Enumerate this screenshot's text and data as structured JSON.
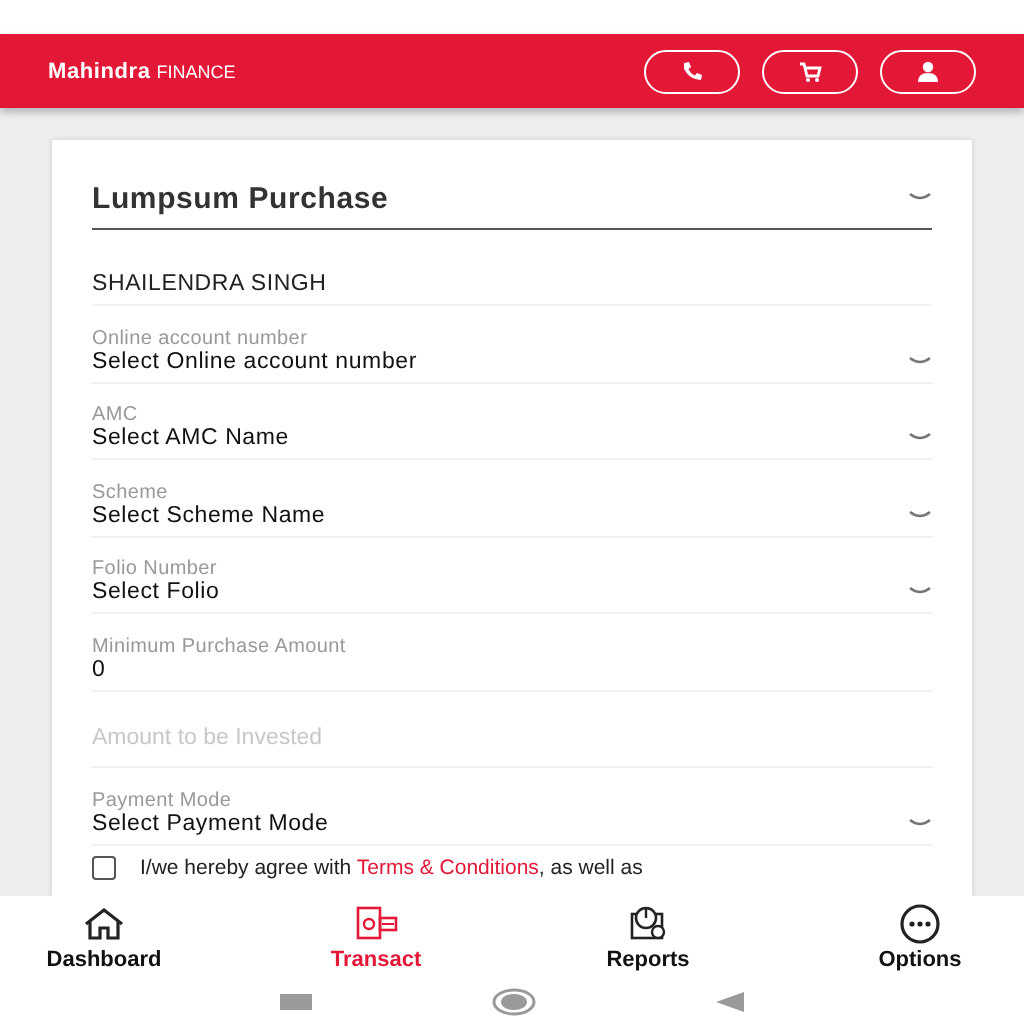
{
  "header": {
    "logo_brand": "Mahindra",
    "logo_suffix": "FINANCE",
    "actions": [
      {
        "kind": "phone"
      },
      {
        "kind": "cart"
      },
      {
        "kind": "user"
      }
    ]
  },
  "form": {
    "title": "Lumpsum Purchase",
    "investor_name": "SHAILENDRA SINGH",
    "fields": [
      {
        "kind": "select",
        "label": "Online account number",
        "value": "Select Online account number"
      },
      {
        "kind": "select",
        "label": "AMC",
        "value": "Select AMC Name"
      },
      {
        "kind": "select",
        "label": "Scheme",
        "value": "Select Scheme Name"
      },
      {
        "kind": "select",
        "label": "Folio Number",
        "value": "Select Folio"
      },
      {
        "kind": "text",
        "label": "Minimum Purchase Amount",
        "value": "0"
      },
      {
        "kind": "input",
        "placeholder": "Amount to be Invested"
      },
      {
        "kind": "select",
        "label": "Payment Mode",
        "value": "Select Payment Mode"
      }
    ],
    "agreement": {
      "checked": false,
      "before": "I/we hereby agree with ",
      "link": "Terms & Conditions",
      "after": ", as well as"
    }
  },
  "bottom_nav": [
    {
      "kind": "dashboard",
      "label": "Dashboard",
      "selected": false
    },
    {
      "kind": "transact",
      "label": "Transact",
      "selected": true
    },
    {
      "kind": "reports",
      "label": "Reports",
      "selected": false
    },
    {
      "kind": "options",
      "label": "Options",
      "selected": false
    }
  ]
}
